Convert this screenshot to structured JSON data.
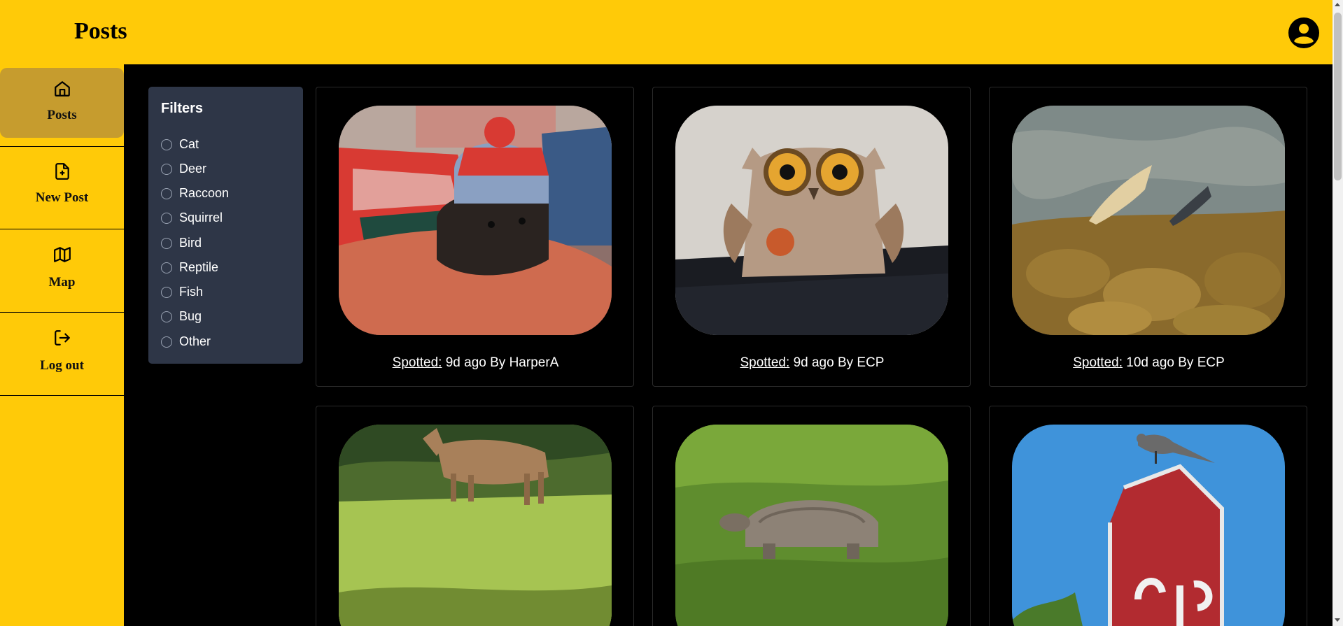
{
  "header": {
    "title": "Posts",
    "account_icon": "account-circle-icon"
  },
  "nav": [
    {
      "label": "Posts",
      "icon": "home-icon",
      "active": true
    },
    {
      "label": "New Post",
      "icon": "file-plus-icon",
      "active": false
    },
    {
      "label": "Map",
      "icon": "map-icon",
      "active": false
    },
    {
      "label": "Log out",
      "icon": "logout-icon",
      "active": false
    }
  ],
  "filters": {
    "title": "Filters",
    "options": [
      "Cat",
      "Deer",
      "Raccoon",
      "Squirrel",
      "Bird",
      "Reptile",
      "Fish",
      "Bug",
      "Other"
    ]
  },
  "posts": [
    {
      "spotted_label": "Spotted:",
      "time_author": "9d ago By HarperA",
      "image": "cat in knit hat"
    },
    {
      "spotted_label": "Spotted:",
      "time_author": "9d ago By ECP",
      "image": "stuffed owl"
    },
    {
      "spotted_label": "Spotted:",
      "time_author": "10d ago By ECP",
      "image": "fish in stream"
    },
    {
      "spotted_label": "",
      "time_author": "",
      "image": "deer in grass"
    },
    {
      "spotted_label": "",
      "time_author": "",
      "image": "tortoise in grass"
    },
    {
      "spotted_label": "",
      "time_author": "",
      "image": "bird on stop sign"
    }
  ],
  "colors": {
    "brand_yellow": "#FFCA08",
    "active_nav": "#C69C2E",
    "filter_panel": "#2E3647",
    "background": "#000000"
  }
}
